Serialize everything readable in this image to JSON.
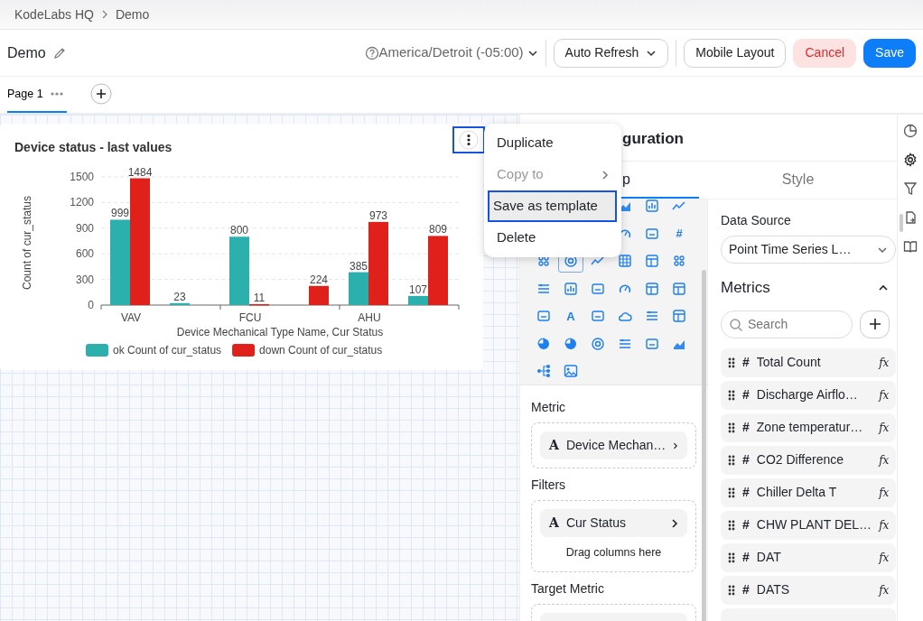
{
  "breadcrumb": [
    {
      "label": "KodeLabs HQ"
    },
    {
      "label": "Demo"
    }
  ],
  "header": {
    "title": "Demo",
    "timezone": "America/Detroit (-05:00)",
    "auto_refresh": "Auto Refresh",
    "buttons": [
      {
        "label": "Mobile Layout",
        "kind": "outline"
      },
      {
        "label": "Cancel",
        "kind": "cancel"
      },
      {
        "label": "Save",
        "kind": "primary"
      }
    ]
  },
  "pages": [
    {
      "label": "Page 1",
      "selected": true
    }
  ],
  "widget": {
    "title": "Device status - last values",
    "chart_data": {
      "type": "bar",
      "xlabel": "Device Mechanical Type Name, Cur Status",
      "ylabel": "Count of cur_status",
      "categories": [
        "VAV",
        null,
        "FCU",
        null,
        "AHU",
        null
      ],
      "ylim": [
        0,
        1500
      ],
      "grid": true,
      "legend": "bottom",
      "yticks": [
        0,
        300,
        600,
        900,
        1200,
        1500
      ],
      "data_labels": true,
      "series": [
        {
          "name": "ok Count of cur_status",
          "color": "#2bb0ad",
          "values": [
            999,
            23,
            800,
            null,
            385,
            107
          ]
        },
        {
          "name": "down Count of cur_status",
          "color": "#e0201a",
          "values": [
            1484,
            null,
            11,
            224,
            973,
            809
          ]
        }
      ]
    }
  },
  "context_menu": {
    "items": [
      {
        "label": "Duplicate",
        "disabled": false,
        "submenu": false,
        "focused": false
      },
      {
        "label": "Copy to",
        "disabled": true,
        "submenu": true,
        "focused": false
      },
      {
        "label": "Save as template",
        "disabled": false,
        "submenu": false,
        "focused": true
      },
      {
        "label": "Delete",
        "disabled": false,
        "submenu": false,
        "focused": false
      }
    ]
  },
  "config": {
    "title": "guration",
    "tabs": [
      {
        "label": "p",
        "selected": true
      },
      {
        "label": "Style",
        "selected": false
      }
    ],
    "widget_types": [
      [
        {
          "kind": "area",
          "selected": false
        },
        {
          "kind": "bars",
          "selected": false
        },
        {
          "kind": "line",
          "selected": false
        }
      ],
      [
        {
          "kind": "gauge",
          "selected": false
        },
        {
          "kind": "card",
          "selected": false
        },
        {
          "kind": "glyph",
          "glyph": "#",
          "selected": false
        }
      ],
      [
        {
          "kind": "dots",
          "selected": false
        },
        {
          "kind": "target",
          "selected": true
        },
        {
          "kind": "line",
          "selected": false
        },
        {
          "kind": "table",
          "selected": false
        },
        {
          "kind": "panel",
          "selected": false
        },
        {
          "kind": "dots",
          "selected": false
        }
      ],
      [
        {
          "kind": "list",
          "selected": false
        },
        {
          "kind": "bars",
          "selected": false
        },
        {
          "kind": "card",
          "selected": false
        },
        {
          "kind": "gauge",
          "selected": false
        },
        {
          "kind": "panel",
          "selected": false
        },
        {
          "kind": "panel",
          "selected": false
        }
      ],
      [
        {
          "kind": "card",
          "selected": false
        },
        {
          "kind": "glyph",
          "glyph": "A",
          "selected": false
        },
        {
          "kind": "card",
          "selected": false
        },
        {
          "kind": "cloud",
          "selected": false
        },
        {
          "kind": "list",
          "selected": false
        },
        {
          "kind": "panel",
          "selected": false
        }
      ],
      [
        {
          "kind": "pie",
          "selected": false
        },
        {
          "kind": "pie",
          "selected": false
        },
        {
          "kind": "target",
          "selected": false
        },
        {
          "kind": "list",
          "selected": false
        },
        {
          "kind": "card",
          "selected": false
        },
        {
          "kind": "area",
          "selected": false
        }
      ],
      [
        {
          "kind": "tree",
          "selected": false
        },
        {
          "kind": "image",
          "selected": false
        }
      ]
    ],
    "sections": [
      {
        "label": "Metric",
        "chips": [
          {
            "type": "A",
            "label": "Device Mechan…"
          }
        ]
      },
      {
        "label": "Filters",
        "chips": [
          {
            "type": "A",
            "label": "Cur Status"
          }
        ],
        "hint": "Drag columns here"
      },
      {
        "label": "Target Metric",
        "partial_chip": true
      }
    ],
    "data_source": {
      "label": "Data Source",
      "value": "Point Time Series L…"
    },
    "metrics": {
      "title": "Metrics",
      "expanded": true,
      "search_placeholder": "Search",
      "items": [
        {
          "type": "#",
          "label": "Total Count",
          "action": "fx"
        },
        {
          "type": "#",
          "label": "Discharge Airflo…",
          "action": "fx"
        },
        {
          "type": "#",
          "label": "Zone temperatur…",
          "action": "fx"
        },
        {
          "type": "#",
          "label": "CO2 Difference",
          "action": "fx"
        },
        {
          "type": "#",
          "label": "Chiller Delta T",
          "action": "fx"
        },
        {
          "type": "#",
          "label": "CHW PLANT DEL…",
          "action": "fx"
        },
        {
          "type": "#",
          "label": "DAT",
          "action": "fx"
        },
        {
          "type": "#",
          "label": "DATS",
          "action": "fx"
        }
      ],
      "partial_row": true
    }
  }
}
